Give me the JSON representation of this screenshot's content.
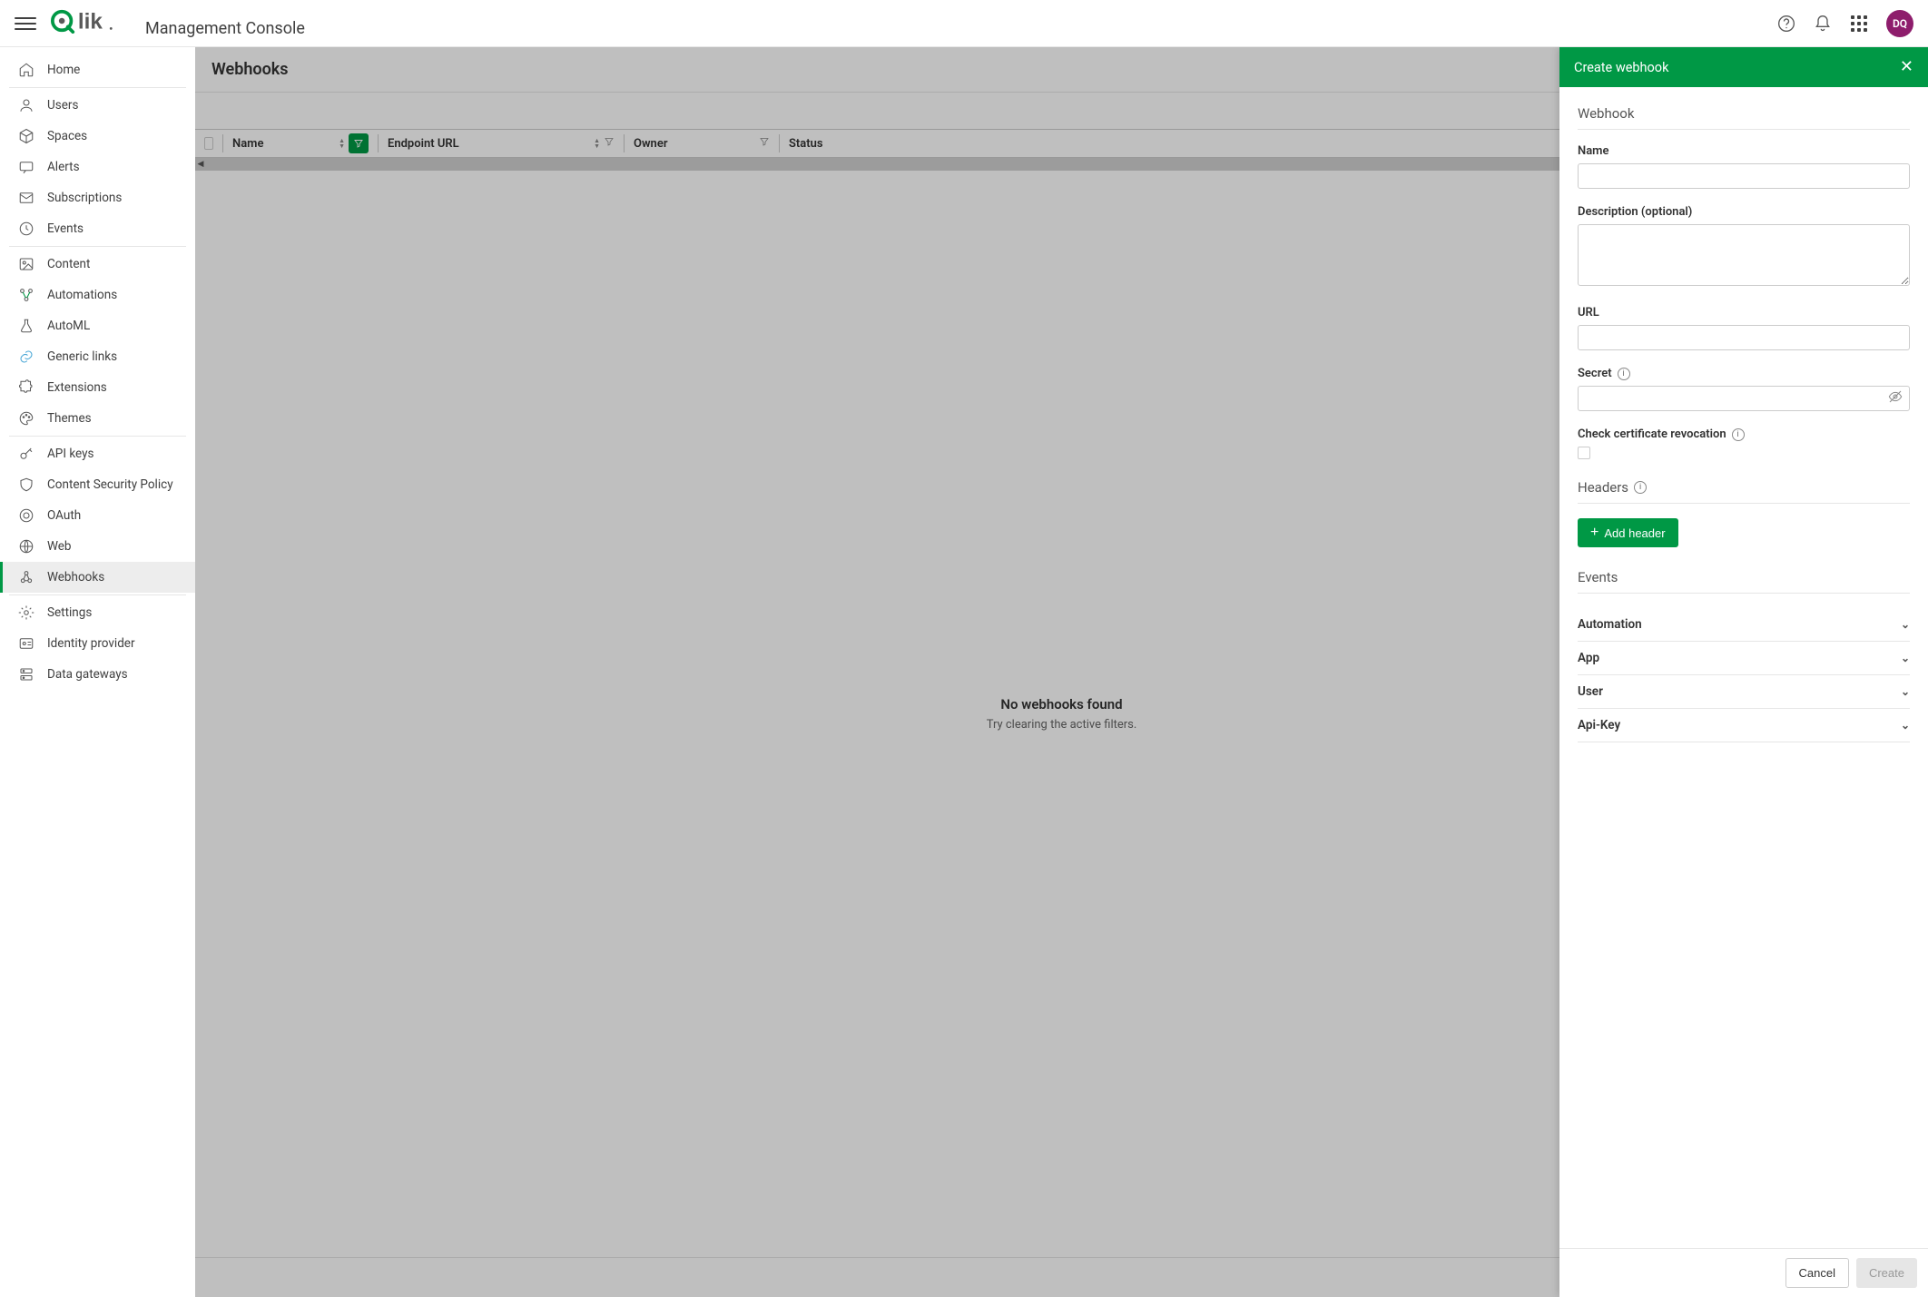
{
  "header": {
    "app_title": "Management Console",
    "avatar_initials": "DQ"
  },
  "sidebar": {
    "groups": [
      {
        "items": [
          {
            "id": "home",
            "label": "Home",
            "icon": "home"
          }
        ]
      },
      {
        "items": [
          {
            "id": "users",
            "label": "Users",
            "icon": "user"
          },
          {
            "id": "spaces",
            "label": "Spaces",
            "icon": "cube"
          },
          {
            "id": "alerts",
            "label": "Alerts",
            "icon": "chat"
          },
          {
            "id": "subscriptions",
            "label": "Subscriptions",
            "icon": "mail"
          },
          {
            "id": "events",
            "label": "Events",
            "icon": "clock"
          }
        ]
      },
      {
        "items": [
          {
            "id": "content",
            "label": "Content",
            "icon": "image"
          },
          {
            "id": "automations",
            "label": "Automations",
            "icon": "flow"
          },
          {
            "id": "automl",
            "label": "AutoML",
            "icon": "flask"
          },
          {
            "id": "generic-links",
            "label": "Generic links",
            "icon": "link"
          },
          {
            "id": "extensions",
            "label": "Extensions",
            "icon": "puzzle"
          },
          {
            "id": "themes",
            "label": "Themes",
            "icon": "palette"
          }
        ]
      },
      {
        "items": [
          {
            "id": "api-keys",
            "label": "API keys",
            "icon": "key"
          },
          {
            "id": "csp",
            "label": "Content Security Policy",
            "icon": "shield"
          },
          {
            "id": "oauth",
            "label": "OAuth",
            "icon": "token"
          },
          {
            "id": "web",
            "label": "Web",
            "icon": "globe"
          },
          {
            "id": "webhooks",
            "label": "Webhooks",
            "icon": "webhook",
            "active": true
          }
        ]
      },
      {
        "items": [
          {
            "id": "settings",
            "label": "Settings",
            "icon": "gear"
          },
          {
            "id": "idp",
            "label": "Identity provider",
            "icon": "id"
          },
          {
            "id": "gateways",
            "label": "Data gateways",
            "icon": "server"
          }
        ]
      }
    ]
  },
  "main": {
    "title": "Webhooks",
    "columns": {
      "name": "Name",
      "endpoint": "Endpoint URL",
      "owner": "Owner",
      "status": "Status"
    },
    "empty_title": "No webhooks found",
    "empty_sub": "Try clearing the active filters."
  },
  "drawer": {
    "title": "Create webhook",
    "section_webhook": "Webhook",
    "label_name": "Name",
    "label_description": "Description (optional)",
    "label_url": "URL",
    "label_secret": "Secret",
    "label_check_cert": "Check certificate revocation",
    "section_headers": "Headers",
    "btn_add_header": "Add header",
    "section_events": "Events",
    "event_categories": [
      "Automation",
      "App",
      "User",
      "Api-Key"
    ],
    "btn_cancel": "Cancel",
    "btn_create": "Create",
    "form": {
      "name": "",
      "description": "",
      "url": "",
      "secret": ""
    }
  }
}
